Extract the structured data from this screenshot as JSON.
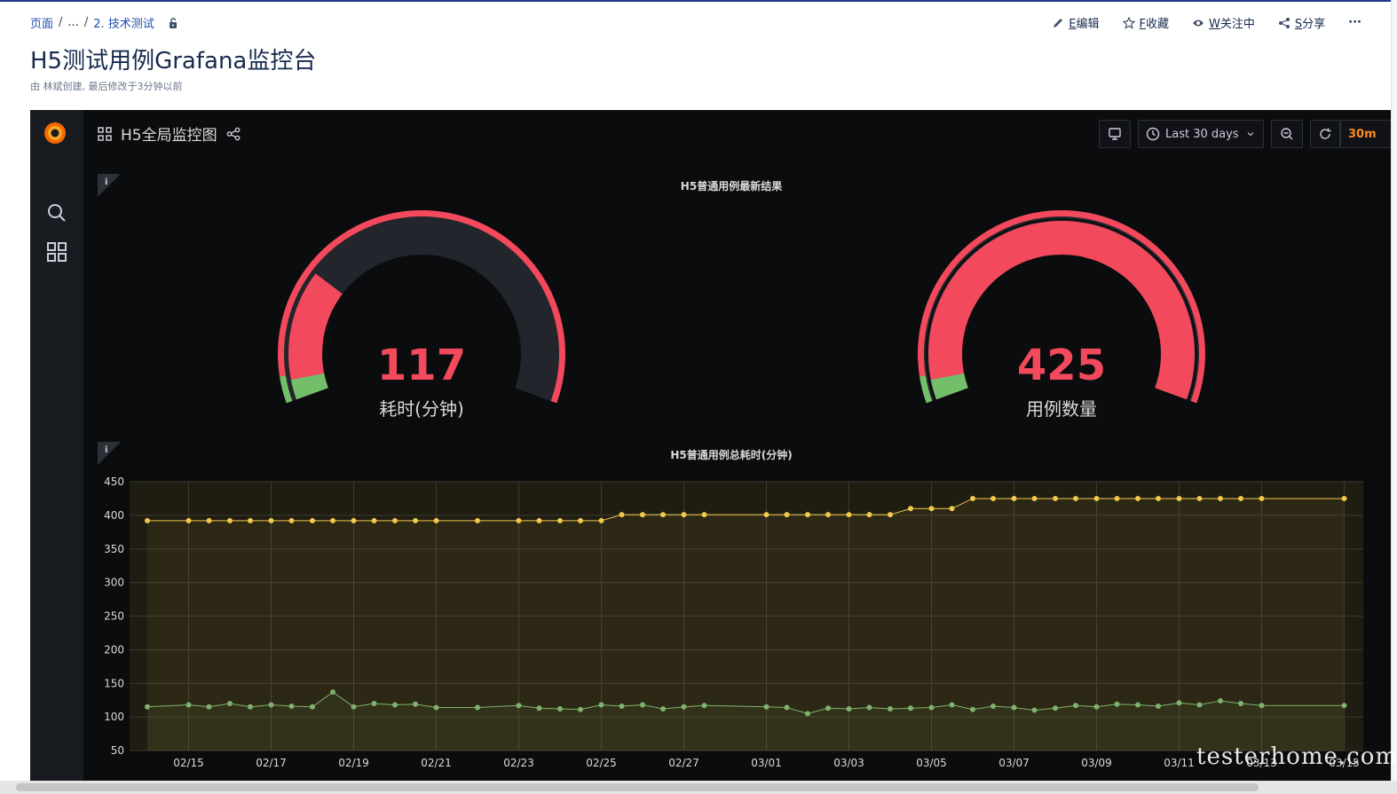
{
  "breadcrumb": {
    "root": "页面",
    "ellipsis": "...",
    "section": "2. 技术测试"
  },
  "page": {
    "title": "H5测试用例Grafana监控台",
    "byline": "由 林斌创建, 最后修改于3分钟以前"
  },
  "actions": {
    "edit_key": "E",
    "edit_label": "编辑",
    "fav_key": "F",
    "fav_label": "收藏",
    "watch_key": "W",
    "watch_label": "关注中",
    "share_key": "S",
    "share_label": "分享",
    "more": "···"
  },
  "grafana": {
    "dashboard_title": "H5全局监控图",
    "time_range": "Last 30 days",
    "refresh": "30m",
    "gauge_panel": {
      "title": "H5普通用例最新结果",
      "gauges": [
        {
          "value": "117",
          "label": "耗时(分钟)",
          "fraction": 0.26
        },
        {
          "value": "425",
          "label": "用例数量",
          "fraction": 1.0
        }
      ]
    },
    "graph_panel": {
      "title": "H5普通用例总耗时(分钟)"
    }
  },
  "colors": {
    "accent_red": "#f2495c",
    "gauge_bg": "#22252b",
    "green": "#73bf69",
    "yellow": "#fade2a",
    "series_a": "#f2c94c",
    "series_b": "#7eb26d",
    "orange": "#ff8a1e"
  },
  "chart_data": {
    "type": "line",
    "title": "H5普通用例总耗时(分钟)",
    "ylim": [
      50,
      450
    ],
    "yticks": [
      450,
      400,
      350,
      300,
      250,
      200,
      150,
      100,
      50
    ],
    "xticks": [
      "02/15",
      "02/17",
      "02/19",
      "02/21",
      "02/23",
      "02/25",
      "02/27",
      "03/01",
      "03/03",
      "03/05",
      "03/07",
      "03/09",
      "03/11",
      "03/13",
      "03/15"
    ],
    "grid": true,
    "series": [
      {
        "x": [
          "02/14",
          "02/15",
          "02/15",
          "02/16",
          "02/16",
          "02/17",
          "02/17",
          "02/18",
          "02/18",
          "02/19",
          "02/19",
          "02/20",
          "02/20",
          "02/21",
          "02/22",
          "02/23",
          "02/23",
          "02/24",
          "02/24",
          "02/25",
          "02/25",
          "02/26",
          "02/26",
          "02/27",
          "02/27",
          "03/01",
          "03/01",
          "03/02",
          "03/02",
          "03/03",
          "03/03",
          "03/04",
          "03/04",
          "03/05",
          "03/05",
          "03/06",
          "03/06",
          "03/07",
          "03/07",
          "03/08",
          "03/08",
          "03/09",
          "03/09",
          "03/10",
          "03/10",
          "03/11",
          "03/11",
          "03/12",
          "03/12",
          "03/13",
          "03/15"
        ],
        "values": [
          392,
          392,
          392,
          392,
          392,
          392,
          392,
          392,
          392,
          392,
          392,
          392,
          392,
          392,
          392,
          392,
          392,
          392,
          392,
          392,
          401,
          401,
          401,
          401,
          401,
          401,
          401,
          401,
          401,
          401,
          401,
          401,
          410,
          410,
          410,
          425,
          425,
          425,
          425,
          425,
          425,
          425,
          425,
          425,
          425,
          425,
          425,
          425,
          425,
          425,
          425
        ]
      },
      {
        "x": [
          "02/14",
          "02/15",
          "02/15",
          "02/16",
          "02/16",
          "02/17",
          "02/17",
          "02/18",
          "02/18",
          "02/19",
          "02/19",
          "02/20",
          "02/20",
          "02/21",
          "02/22",
          "02/23",
          "02/23",
          "02/24",
          "02/24",
          "02/25",
          "02/25",
          "02/26",
          "02/26",
          "02/27",
          "02/27",
          "03/01",
          "03/01",
          "03/02",
          "03/02",
          "03/03",
          "03/03",
          "03/04",
          "03/04",
          "03/05",
          "03/05",
          "03/06",
          "03/06",
          "03/07",
          "03/07",
          "03/08",
          "03/08",
          "03/09",
          "03/09",
          "03/10",
          "03/10",
          "03/11",
          "03/11",
          "03/12",
          "03/12",
          "03/13",
          "03/15"
        ],
        "values": [
          115,
          118,
          115,
          120,
          115,
          118,
          116,
          115,
          137,
          115,
          120,
          118,
          119,
          114,
          114,
          117,
          113,
          112,
          111,
          118,
          116,
          118,
          112,
          115,
          117,
          115,
          114,
          105,
          113,
          112,
          114,
          112,
          113,
          114,
          118,
          111,
          116,
          114,
          110,
          113,
          117,
          115,
          119,
          118,
          116,
          121,
          118,
          124,
          120,
          117,
          117
        ]
      }
    ]
  }
}
